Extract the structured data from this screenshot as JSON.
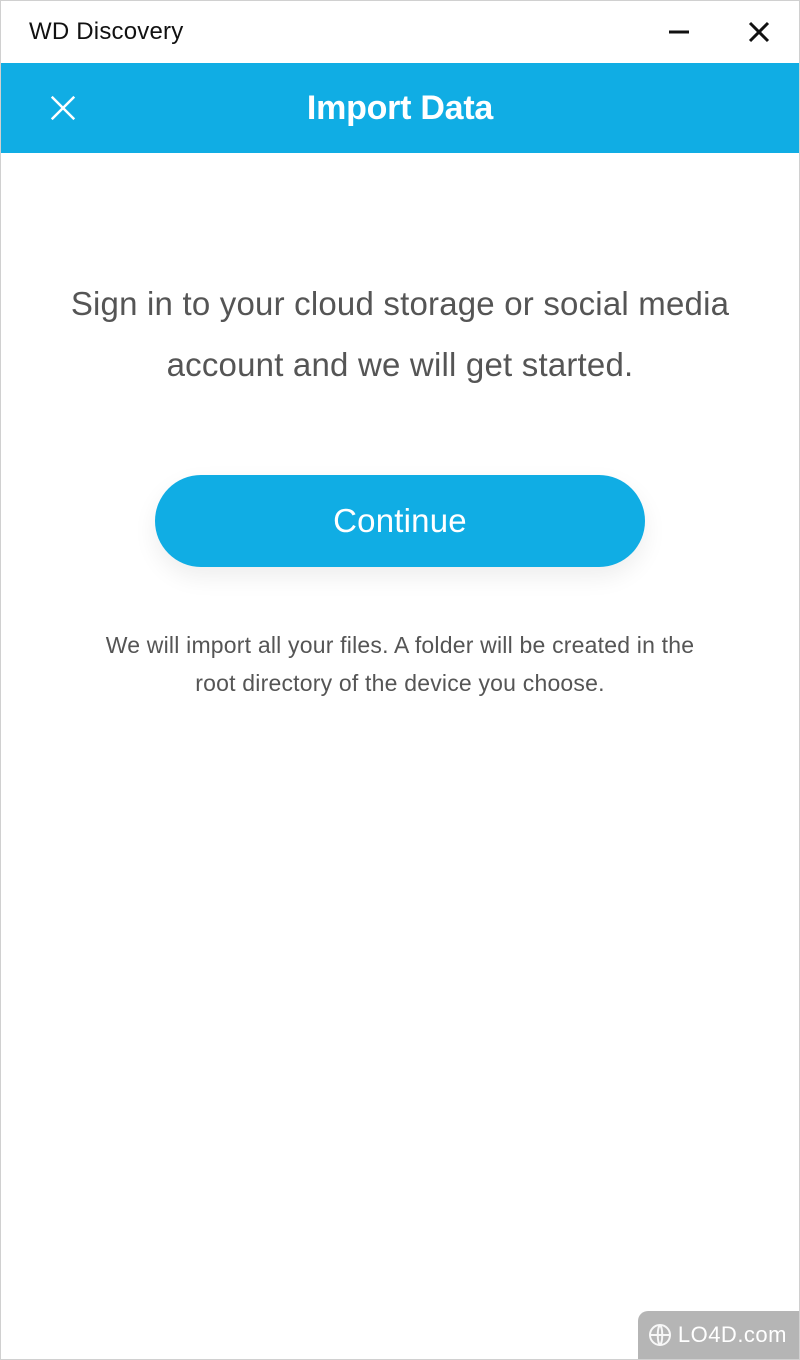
{
  "window": {
    "title": "WD Discovery"
  },
  "header": {
    "title": "Import Data"
  },
  "main": {
    "lead_text": "Sign in to your cloud storage or social media account and we will get started.",
    "continue_label": "Continue",
    "sub_text": "We will import all your files. A folder will be created in the root directory of the device you choose."
  },
  "watermark": {
    "text": "LO4D.com"
  },
  "colors": {
    "accent": "#10ade4"
  }
}
